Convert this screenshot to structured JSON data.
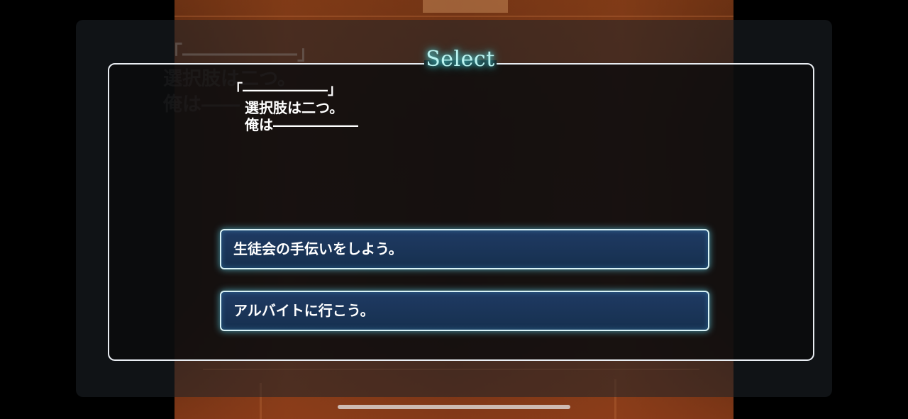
{
  "select_title": "Select",
  "dialogue": {
    "open_bracket": "「",
    "dash": "――――――",
    "close_bracket": "」",
    "line1": "選択肢は二つ。",
    "line2": "俺は――――――"
  },
  "ghost_dialogue": "「――――――」\n選択肢は二つ。\n俺は――",
  "choices": [
    {
      "label": "生徒会の手伝いをしよう。"
    },
    {
      "label": "アルバイトに行こう。"
    }
  ],
  "colors": {
    "title_glow": "#4fe1e6",
    "choice_fill": "#1f3a63",
    "choice_border": "#d8f2f6",
    "panel_border": "#e9edf2"
  }
}
